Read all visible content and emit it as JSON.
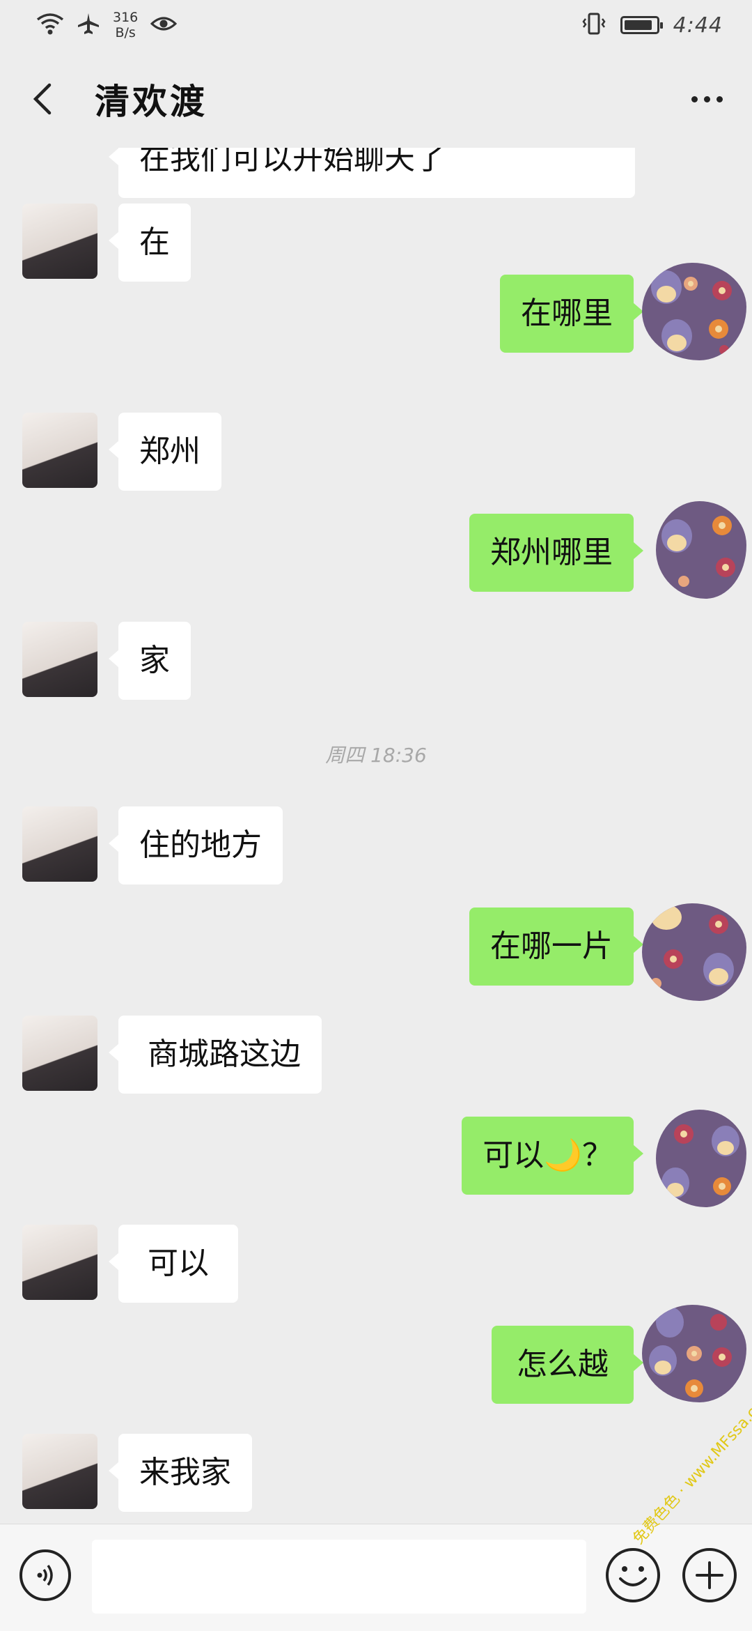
{
  "status_bar": {
    "net_speed_value": "316",
    "net_speed_unit": "B/s",
    "time": "4:44",
    "battery_level": 0.9
  },
  "header": {
    "title": "清欢渡"
  },
  "chat": {
    "partial_top_message": "在我们可以开始聊天了",
    "messages": [
      {
        "side": "in",
        "text": "在"
      },
      {
        "side": "out",
        "text": "在哪里"
      },
      {
        "side": "in",
        "text": "郑州"
      },
      {
        "side": "out",
        "text": "郑州哪里"
      },
      {
        "side": "in",
        "text": "家"
      },
      {
        "side": "in",
        "text": "住的地方"
      },
      {
        "side": "out",
        "text": "在哪一片"
      },
      {
        "side": "in",
        "text": "商城路这边"
      },
      {
        "side": "out",
        "text": "可以🌙？"
      },
      {
        "side": "in",
        "text": "可以"
      },
      {
        "side": "out",
        "text": "怎么越"
      },
      {
        "side": "in",
        "text": "来我家"
      }
    ],
    "timestamp": "周四 18:36"
  },
  "input_bar": {
    "placeholder": ""
  },
  "watermark": "免费色色 · www.MFssa.com",
  "colors": {
    "outgoing_bubble": "#95ec69",
    "incoming_bubble": "#ffffff",
    "background": "#ededed"
  }
}
